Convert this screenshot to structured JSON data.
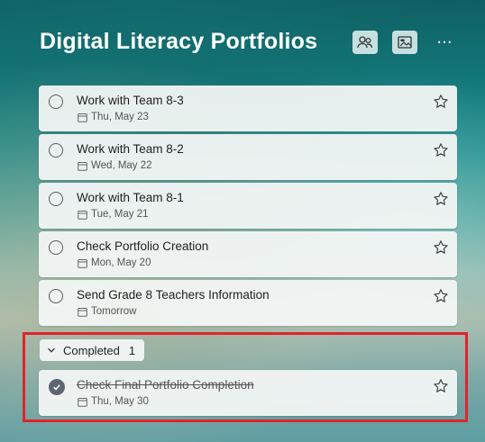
{
  "header": {
    "title": "Digital Literacy Portfolios",
    "share_icon": "people-icon",
    "background_icon": "image-icon",
    "more_label": "···"
  },
  "tasks": [
    {
      "title": "Work with Team 8-3",
      "due": "Thu, May 23"
    },
    {
      "title": "Work with Team 8-2",
      "due": "Wed, May 22"
    },
    {
      "title": "Work with Team 8-1",
      "due": "Tue, May 21"
    },
    {
      "title": "Check Portfolio Creation",
      "due": "Mon, May 20"
    },
    {
      "title": "Send Grade 8 Teachers Information",
      "due": "Tomorrow"
    }
  ],
  "completed": {
    "label": "Completed",
    "count": "1",
    "tasks": [
      {
        "title": "Check Final Portfolio Completion",
        "due": "Thu, May 30"
      }
    ]
  },
  "colors": {
    "highlight": "#e0242d",
    "completed_check": "#5f6570"
  }
}
